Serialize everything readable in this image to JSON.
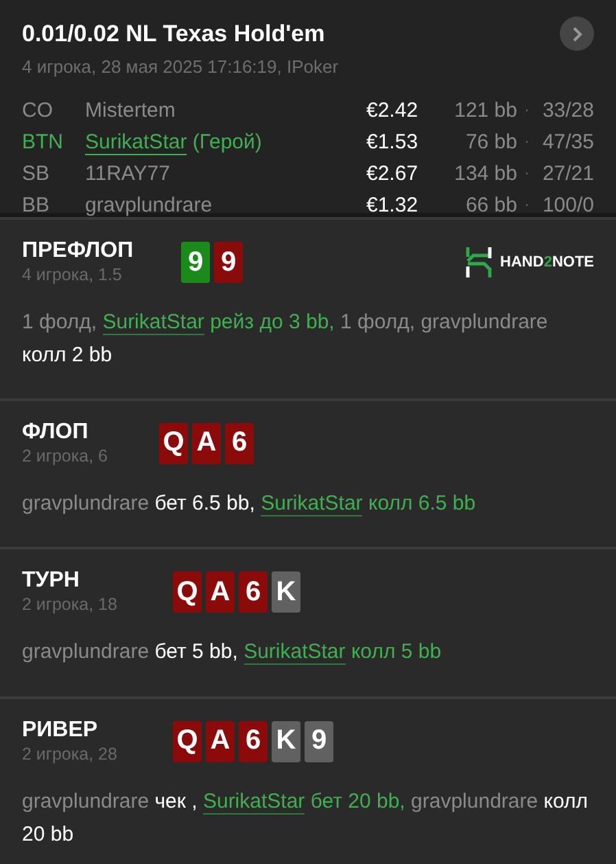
{
  "header": {
    "title": "0.01/0.02 NL Texas Hold'em",
    "subtitle": "4 игрока, 28 мая 2025 17:16:19, IPoker"
  },
  "players": [
    {
      "position": "CO",
      "name": "Mistertem",
      "hero": false,
      "stack": "€2.42",
      "bb": "121 bb",
      "dot": "·",
      "stats": "33/28"
    },
    {
      "position": "BTN",
      "name": "SurikatStar",
      "hero": true,
      "hero_label": "(Герой)",
      "stack": "€1.53",
      "bb": "76 bb",
      "dot": "·",
      "stats": "47/35"
    },
    {
      "position": "SB",
      "name": "11RAY77",
      "hero": false,
      "stack": "€2.67",
      "bb": "134 bb",
      "dot": "·",
      "stats": "27/21"
    },
    {
      "position": "BB",
      "name": "gravplundrare",
      "hero": false,
      "stack": "€1.32",
      "bb": "66 bb",
      "dot": "·",
      "stats": "100/0"
    }
  ],
  "streets": [
    {
      "name": "ПРЕФЛОП",
      "info": "4 игрока, 1.5",
      "logo": [
        "HAND",
        "2",
        "NOTE"
      ],
      "cards": [
        {
          "rank": "9",
          "color": "#1a8a1a"
        },
        {
          "rank": "9",
          "color": "#8b0a0a"
        }
      ],
      "actions": [
        {
          "kind": "muted",
          "text": "1 фолд,"
        },
        {
          "kind": "hero_name",
          "text": "SurikatStar"
        },
        {
          "kind": "hero",
          "text": "рейз до 3 bb,"
        },
        {
          "kind": "muted",
          "text": "1 фолд, gravplundrare"
        },
        {
          "kind": "plain",
          "text": "колл 2 bb"
        }
      ]
    },
    {
      "name": "ФЛОП",
      "info": "2 игрока, 6",
      "cards": [
        {
          "rank": "Q",
          "color": "#8b0a0a"
        },
        {
          "rank": "A",
          "color": "#8b0a0a"
        },
        {
          "rank": "6",
          "color": "#8b0a0a"
        }
      ],
      "actions": [
        {
          "kind": "muted",
          "text": "gravplundrare"
        },
        {
          "kind": "plain",
          "text": "бет 6.5 bb,"
        },
        {
          "kind": "hero_name",
          "text": "SurikatStar"
        },
        {
          "kind": "hero",
          "text": "колл 6.5 bb"
        }
      ]
    },
    {
      "name": "ТУРН",
      "info": "2 игрока, 18",
      "cards": [
        {
          "rank": "Q",
          "color": "#8b0a0a"
        },
        {
          "rank": "A",
          "color": "#8b0a0a"
        },
        {
          "rank": "6",
          "color": "#8b0a0a"
        },
        {
          "rank": "K",
          "color": "#616161"
        }
      ],
      "actions": [
        {
          "kind": "muted",
          "text": "gravplundrare"
        },
        {
          "kind": "plain",
          "text": "бет 5 bb,"
        },
        {
          "kind": "hero_name",
          "text": "SurikatStar"
        },
        {
          "kind": "hero",
          "text": "колл 5 bb"
        }
      ]
    },
    {
      "name": "РИВЕР",
      "info": "2 игрока, 28",
      "cards": [
        {
          "rank": "Q",
          "color": "#8b0a0a"
        },
        {
          "rank": "A",
          "color": "#8b0a0a"
        },
        {
          "rank": "6",
          "color": "#8b0a0a"
        },
        {
          "rank": "K",
          "color": "#616161"
        },
        {
          "rank": "9",
          "color": "#616161"
        }
      ],
      "actions": [
        {
          "kind": "muted",
          "text": "gravplundrare"
        },
        {
          "kind": "plain",
          "text": "чек ,"
        },
        {
          "kind": "hero_name",
          "text": "SurikatStar"
        },
        {
          "kind": "hero",
          "text": "бет 20 bb,"
        },
        {
          "kind": "muted",
          "text": "gravplundrare"
        },
        {
          "kind": "plain",
          "text": "колл 20 bb"
        }
      ]
    }
  ]
}
